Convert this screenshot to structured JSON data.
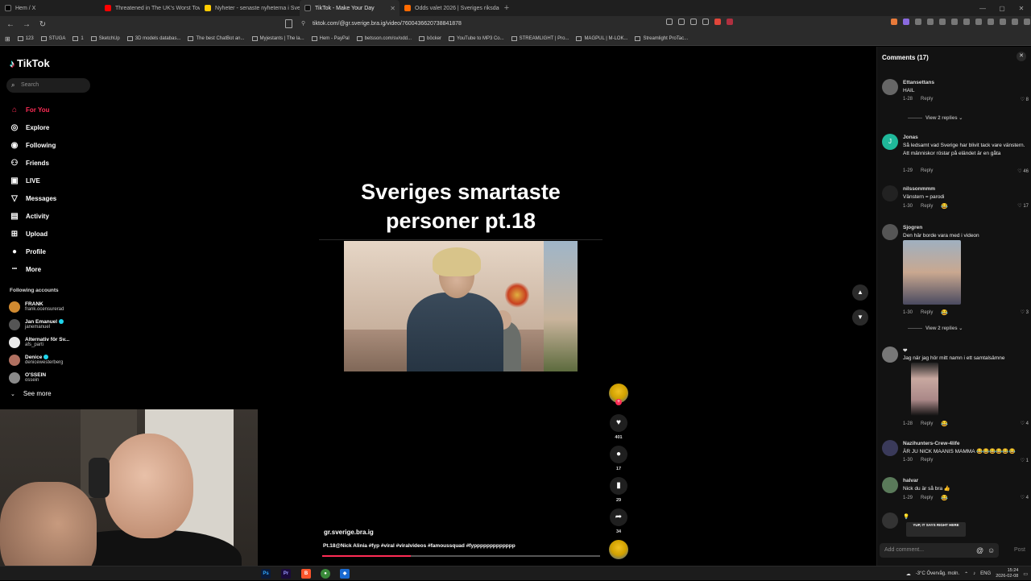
{
  "browser": {
    "tabs": [
      {
        "title": "Hem / X",
        "color": "#000000"
      },
      {
        "title": "Threatened in The UK's Worst Town",
        "color": "#ff0000"
      },
      {
        "title": "Nyheter - senaste nyheterna i Sverige",
        "color": "#ffcc00"
      },
      {
        "title": "TikTok - Make Your Day",
        "color": "#111111",
        "active": true
      },
      {
        "title": "Odds valet 2026 | Sveriges riksdagsval",
        "color": "#ff6a00"
      }
    ],
    "url": "tiktok.com/@gr.sverige.bra.ig/video/7600436620738841878",
    "bookmarks": [
      "123",
      "STUGA",
      "1",
      "SketchUp",
      "3D models databas...",
      "The best ChatBot an...",
      "Myjestants | The la...",
      "Hem - PayPal",
      "betsson.com/sv/odd...",
      "böcker",
      "YouTube to MP3 Co...",
      "STREAMLIGHT | Pro...",
      "MAGPUL | M-LOK...",
      "Streamlight ProTac..."
    ]
  },
  "sidebar": {
    "logo": "TikTok",
    "search_placeholder": "Search",
    "nav": [
      {
        "label": "For You",
        "icon": "home-icon",
        "glyph": "⌂",
        "active": true
      },
      {
        "label": "Explore",
        "icon": "compass-icon",
        "glyph": "◎"
      },
      {
        "label": "Following",
        "icon": "following-icon",
        "glyph": "◉"
      },
      {
        "label": "Friends",
        "icon": "friends-icon",
        "glyph": "⚇"
      },
      {
        "label": "LIVE",
        "icon": "live-icon",
        "glyph": "▣"
      },
      {
        "label": "Messages",
        "icon": "messages-icon",
        "glyph": "▽"
      },
      {
        "label": "Activity",
        "icon": "activity-icon",
        "glyph": "▤"
      },
      {
        "label": "Upload",
        "icon": "upload-icon",
        "glyph": "⊞"
      },
      {
        "label": "Profile",
        "icon": "profile-icon",
        "glyph": "●"
      },
      {
        "label": "More",
        "icon": "more-icon",
        "glyph": "•••"
      }
    ],
    "following_title": "Following accounts",
    "accounts": [
      {
        "name": "FRANK",
        "handle": "frank.ocensurerad",
        "color": "#d08a30"
      },
      {
        "name": "Jan Emanuel",
        "handle": "janemanuel",
        "color": "#555555",
        "verified": true
      },
      {
        "name": "Alternativ för Sv...",
        "handle": "afs_parti",
        "color": "#e8e8e8"
      },
      {
        "name": "Denice",
        "handle": "denicewesterberg",
        "color": "#b07060",
        "verified": true
      },
      {
        "name": "O'SSEIN",
        "handle": "ossein",
        "color": "#8a8a8a"
      }
    ],
    "see_more": "See more"
  },
  "video": {
    "title_line1": "Sveriges smartaste",
    "title_line2": "personer pt.18",
    "author": "gr.sverige.bra.ig",
    "caption": "Pt.18@Nick Alinia #fyp #viral #viralvideos #famoussquad #fyppppppppppppp",
    "progress": 0.32,
    "likes": "401",
    "comments": "17",
    "saves": "29",
    "shares": "34"
  },
  "comments_panel": {
    "title": "Comments (17)",
    "input_placeholder": "Add comment...",
    "post_label": "Post",
    "reply_label": "Reply",
    "view_replies": "View 2 replies",
    "items": [
      {
        "user": "Ettansettans",
        "text": "HAIL",
        "date": "1-28",
        "likes": "8"
      },
      {
        "user": "Jonas",
        "text": "Så ledsamt vad Sverige har blivit tack vare vänstern. Att människor röstar på eländet är en gåta",
        "date": "1-29",
        "likes": "46"
      },
      {
        "user": "nilssonmmm",
        "text": "Vänstern = parodi",
        "date": "1-30",
        "likes": "17"
      },
      {
        "user": "Sjogren",
        "text": "Den här borde vara med i videon",
        "date": "1-30",
        "likes": "3"
      },
      {
        "user": "❤",
        "text": "Jag när jag hör mitt namn i ett samtalsämne",
        "date": "1-28",
        "likes": "4"
      },
      {
        "user": "Nazihunters-Crew-4life",
        "text": "ÄR JU NICK MAANIS MAMMA 😂😂😂😂😂😂",
        "date": "1-30",
        "likes": "1"
      },
      {
        "user": "halvar",
        "text": "Nick du är så bra 👍",
        "date": "1-29",
        "likes": "4"
      },
      {
        "user": "💡",
        "sticker": "YUP, IT SAYS RIGHT HERE"
      }
    ]
  },
  "taskbar": {
    "weather": "-3°C  Övervåg. moln.",
    "lang": "ENG",
    "time": "15:24",
    "date": "2026-02-08"
  }
}
